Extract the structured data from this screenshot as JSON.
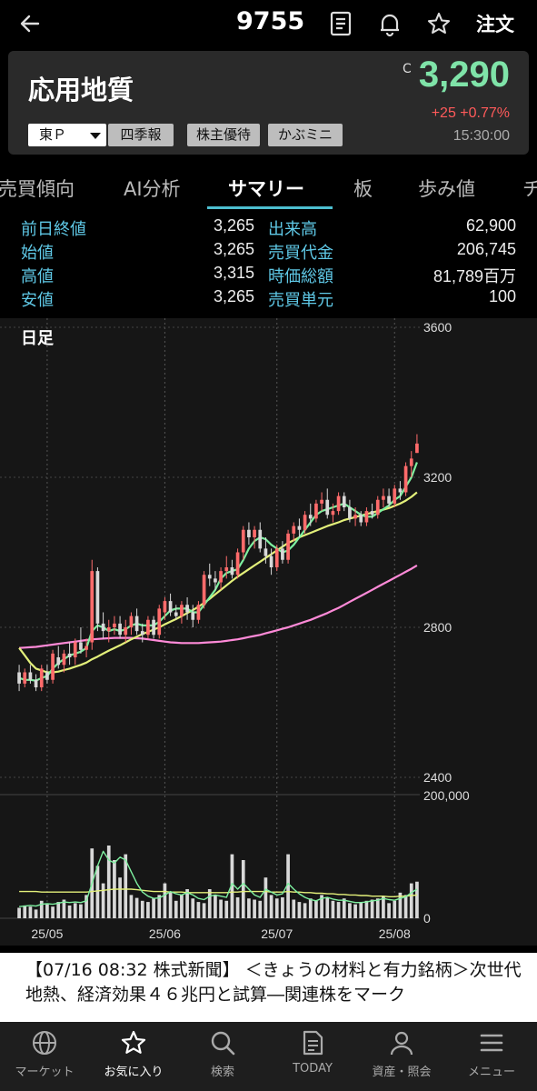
{
  "header": {
    "stock_code": "9755",
    "order_label": "注文",
    "icons": [
      "back-arrow-icon",
      "document-icon",
      "bell-icon",
      "star-icon"
    ]
  },
  "quote": {
    "company_name": "応用地質",
    "close_marker": "C",
    "price": "3,290",
    "change": "+25 +0.77%",
    "time": "15:30:00",
    "price_color": "#7fe3a8",
    "change_color": "#ff5a5a",
    "exchange": "東Ｐ",
    "tags": [
      "四季報",
      "株主優待",
      "かぶミニ"
    ]
  },
  "tabs": [
    {
      "label": "売買傾向",
      "active": false
    },
    {
      "label": "AI分析",
      "active": false
    },
    {
      "label": "サマリー",
      "active": true
    },
    {
      "label": "板",
      "active": false
    },
    {
      "label": "歩み値",
      "active": false
    },
    {
      "label": "チ",
      "active": false
    }
  ],
  "summary": {
    "left": [
      {
        "label": "前日終値",
        "value": "3,265"
      },
      {
        "label": "始値",
        "value": "3,265"
      },
      {
        "label": "高値",
        "value": "3,315"
      },
      {
        "label": "安値",
        "value": "3,265"
      }
    ],
    "right": [
      {
        "label": "出来高",
        "value": "62,900"
      },
      {
        "label": "売買代金",
        "value": "206,745"
      },
      {
        "label": "時価総額",
        "value": "81,789百万"
      },
      {
        "label": "売買単元",
        "value": "100"
      }
    ],
    "label_color": "#5fc8e6"
  },
  "chart_data": {
    "type": "candlestick",
    "period_label": "日足",
    "price_axis_labels": [
      "3600",
      "3200",
      "2800",
      "2400"
    ],
    "ylim": [
      2400,
      3600
    ],
    "volume_axis_labels": [
      "200,000",
      "0"
    ],
    "volume_ylim": [
      0,
      200000
    ],
    "x_labels": [
      {
        "label": "25/05",
        "index": 5
      },
      {
        "label": "25/06",
        "index": 26
      },
      {
        "label": "25/07",
        "index": 46
      },
      {
        "label": "25/08",
        "index": 67
      }
    ],
    "up_color": "#ff6b6b",
    "down_color": "#d8d8d8",
    "ma_short_color": "#7ef0a0",
    "ma_mid_color": "#e3f07a",
    "ma_long_color": "#ff8ad8",
    "candles": [
      {
        "o": 2680,
        "h": 2700,
        "l": 2630,
        "c": 2650
      },
      {
        "o": 2650,
        "h": 2690,
        "l": 2640,
        "c": 2680
      },
      {
        "o": 2680,
        "h": 2700,
        "l": 2650,
        "c": 2660
      },
      {
        "o": 2660,
        "h": 2675,
        "l": 2630,
        "c": 2640
      },
      {
        "o": 2640,
        "h": 2700,
        "l": 2630,
        "c": 2690
      },
      {
        "o": 2680,
        "h": 2700,
        "l": 2650,
        "c": 2660
      },
      {
        "o": 2660,
        "h": 2740,
        "l": 2650,
        "c": 2730
      },
      {
        "o": 2720,
        "h": 2750,
        "l": 2690,
        "c": 2700
      },
      {
        "o": 2700,
        "h": 2740,
        "l": 2680,
        "c": 2730
      },
      {
        "o": 2730,
        "h": 2760,
        "l": 2700,
        "c": 2720
      },
      {
        "o": 2720,
        "h": 2770,
        "l": 2700,
        "c": 2760
      },
      {
        "o": 2760,
        "h": 2800,
        "l": 2730,
        "c": 2740
      },
      {
        "o": 2740,
        "h": 2770,
        "l": 2720,
        "c": 2750
      },
      {
        "o": 2760,
        "h": 2980,
        "l": 2740,
        "c": 2950
      },
      {
        "o": 2950,
        "h": 2960,
        "l": 2790,
        "c": 2810
      },
      {
        "o": 2810,
        "h": 2840,
        "l": 2770,
        "c": 2790
      },
      {
        "o": 2790,
        "h": 2820,
        "l": 2760,
        "c": 2800
      },
      {
        "o": 2800,
        "h": 2830,
        "l": 2780,
        "c": 2810
      },
      {
        "o": 2810,
        "h": 2830,
        "l": 2770,
        "c": 2780
      },
      {
        "o": 2780,
        "h": 2820,
        "l": 2760,
        "c": 2800
      },
      {
        "o": 2800,
        "h": 2840,
        "l": 2780,
        "c": 2830
      },
      {
        "o": 2830,
        "h": 2850,
        "l": 2780,
        "c": 2790
      },
      {
        "o": 2790,
        "h": 2810,
        "l": 2760,
        "c": 2780
      },
      {
        "o": 2780,
        "h": 2830,
        "l": 2770,
        "c": 2820
      },
      {
        "o": 2820,
        "h": 2830,
        "l": 2770,
        "c": 2780
      },
      {
        "o": 2780,
        "h": 2860,
        "l": 2770,
        "c": 2850
      },
      {
        "o": 2840,
        "h": 2880,
        "l": 2820,
        "c": 2870
      },
      {
        "o": 2870,
        "h": 2890,
        "l": 2830,
        "c": 2840
      },
      {
        "o": 2840,
        "h": 2860,
        "l": 2820,
        "c": 2830
      },
      {
        "o": 2830,
        "h": 2870,
        "l": 2810,
        "c": 2860
      },
      {
        "o": 2860,
        "h": 2880,
        "l": 2820,
        "c": 2840
      },
      {
        "o": 2840,
        "h": 2860,
        "l": 2800,
        "c": 2820
      },
      {
        "o": 2820,
        "h": 2870,
        "l": 2810,
        "c": 2860
      },
      {
        "o": 2860,
        "h": 2950,
        "l": 2850,
        "c": 2940
      },
      {
        "o": 2940,
        "h": 2970,
        "l": 2910,
        "c": 2930
      },
      {
        "o": 2930,
        "h": 2950,
        "l": 2900,
        "c": 2920
      },
      {
        "o": 2920,
        "h": 2960,
        "l": 2900,
        "c": 2950
      },
      {
        "o": 2950,
        "h": 2990,
        "l": 2930,
        "c": 2960
      },
      {
        "o": 2960,
        "h": 2980,
        "l": 2930,
        "c": 2940
      },
      {
        "o": 2940,
        "h": 3010,
        "l": 2930,
        "c": 3000
      },
      {
        "o": 3000,
        "h": 3070,
        "l": 2980,
        "c": 3060
      },
      {
        "o": 3060,
        "h": 3080,
        "l": 3020,
        "c": 3040
      },
      {
        "o": 3040,
        "h": 3070,
        "l": 3010,
        "c": 3060
      },
      {
        "o": 3060,
        "h": 3080,
        "l": 3000,
        "c": 3010
      },
      {
        "o": 3010,
        "h": 3040,
        "l": 2970,
        "c": 2990
      },
      {
        "o": 2990,
        "h": 3010,
        "l": 2940,
        "c": 2960
      },
      {
        "o": 2960,
        "h": 3020,
        "l": 2950,
        "c": 3010
      },
      {
        "o": 3010,
        "h": 3030,
        "l": 2970,
        "c": 2980
      },
      {
        "o": 2980,
        "h": 3060,
        "l": 2970,
        "c": 3050
      },
      {
        "o": 3050,
        "h": 3080,
        "l": 3030,
        "c": 3070
      },
      {
        "o": 3070,
        "h": 3090,
        "l": 3040,
        "c": 3060
      },
      {
        "o": 3060,
        "h": 3110,
        "l": 3050,
        "c": 3100
      },
      {
        "o": 3100,
        "h": 3130,
        "l": 3070,
        "c": 3090
      },
      {
        "o": 3090,
        "h": 3140,
        "l": 3080,
        "c": 3130
      },
      {
        "o": 3130,
        "h": 3160,
        "l": 3110,
        "c": 3140
      },
      {
        "o": 3140,
        "h": 3170,
        "l": 3090,
        "c": 3100
      },
      {
        "o": 3100,
        "h": 3130,
        "l": 3080,
        "c": 3110
      },
      {
        "o": 3110,
        "h": 3160,
        "l": 3100,
        "c": 3150
      },
      {
        "o": 3150,
        "h": 3160,
        "l": 3110,
        "c": 3120
      },
      {
        "o": 3120,
        "h": 3140,
        "l": 3080,
        "c": 3090
      },
      {
        "o": 3090,
        "h": 3120,
        "l": 3070,
        "c": 3100
      },
      {
        "o": 3100,
        "h": 3110,
        "l": 3070,
        "c": 3080
      },
      {
        "o": 3080,
        "h": 3120,
        "l": 3070,
        "c": 3110
      },
      {
        "o": 3110,
        "h": 3130,
        "l": 3090,
        "c": 3100
      },
      {
        "o": 3100,
        "h": 3150,
        "l": 3090,
        "c": 3140
      },
      {
        "o": 3140,
        "h": 3170,
        "l": 3120,
        "c": 3150
      },
      {
        "o": 3150,
        "h": 3170,
        "l": 3120,
        "c": 3130
      },
      {
        "o": 3130,
        "h": 3180,
        "l": 3120,
        "c": 3170
      },
      {
        "o": 3170,
        "h": 3190,
        "l": 3140,
        "c": 3160
      },
      {
        "o": 3160,
        "h": 3240,
        "l": 3150,
        "c": 3230
      },
      {
        "o": 3230,
        "h": 3270,
        "l": 3200,
        "c": 3250
      },
      {
        "o": 3265,
        "h": 3315,
        "l": 3265,
        "c": 3290
      }
    ],
    "volumes": [
      18000,
      22000,
      20000,
      15000,
      30000,
      24000,
      20000,
      28000,
      32000,
      22000,
      26000,
      24000,
      40000,
      120000,
      90000,
      60000,
      125000,
      100000,
      70000,
      110000,
      40000,
      35000,
      30000,
      28000,
      34000,
      40000,
      60000,
      45000,
      30000,
      40000,
      50000,
      34000,
      28000,
      26000,
      50000,
      40000,
      32000,
      30000,
      110000,
      36000,
      100000,
      34000,
      32000,
      30000,
      70000,
      40000,
      34000,
      36000,
      110000,
      32000,
      28000,
      26000,
      34000,
      30000,
      40000,
      36000,
      30000,
      28000,
      34000,
      26000,
      24000,
      28000,
      30000,
      32000,
      34000,
      38000,
      26000,
      30000,
      44000,
      40000,
      60000,
      62900
    ],
    "ma_short": [
      2665,
      2660,
      2660,
      2658,
      2665,
      2670,
      2690,
      2705,
      2715,
      2725,
      2730,
      2735,
      2745,
      2790,
      2805,
      2800,
      2790,
      2795,
      2790,
      2795,
      2805,
      2810,
      2805,
      2805,
      2805,
      2815,
      2830,
      2845,
      2850,
      2850,
      2850,
      2840,
      2840,
      2860,
      2880,
      2900,
      2930,
      2945,
      2950,
      2955,
      2980,
      3010,
      3030,
      3040,
      3035,
      3020,
      3010,
      3000,
      3005,
      3020,
      3040,
      3060,
      3080,
      3100,
      3110,
      3115,
      3120,
      3125,
      3130,
      3120,
      3110,
      3100,
      3095,
      3095,
      3105,
      3115,
      3125,
      3140,
      3150,
      3175,
      3200,
      3240
    ],
    "ma_mid": [
      2745,
      2725,
      2705,
      2690,
      2685,
      2680,
      2680,
      2682,
      2686,
      2690,
      2695,
      2700,
      2706,
      2715,
      2722,
      2730,
      2738,
      2745,
      2752,
      2760,
      2768,
      2775,
      2782,
      2788,
      2794,
      2800,
      2808,
      2815,
      2822,
      2830,
      2838,
      2846,
      2855,
      2865,
      2876,
      2888,
      2900,
      2912,
      2924,
      2935,
      2945,
      2955,
      2965,
      2975,
      2985,
      2995,
      3005,
      3015,
      3025,
      3032,
      3040,
      3046,
      3052,
      3058,
      3064,
      3070,
      3075,
      3080,
      3086,
      3090,
      3094,
      3098,
      3102,
      3106,
      3110,
      3114,
      3118,
      3124,
      3130,
      3138,
      3148,
      3160
    ],
    "ma_long": [
      2745,
      2746,
      2747,
      2748,
      2750,
      2752,
      2754,
      2756,
      2758,
      2760,
      2762,
      2764,
      2766,
      2768,
      2769,
      2770,
      2771,
      2772,
      2772,
      2772,
      2772,
      2771,
      2770,
      2768,
      2766,
      2764,
      2762,
      2760,
      2759,
      2758,
      2758,
      2758,
      2758,
      2759,
      2760,
      2761,
      2762,
      2764,
      2766,
      2768,
      2771,
      2774,
      2777,
      2780,
      2784,
      2788,
      2792,
      2796,
      2800,
      2805,
      2810,
      2815,
      2820,
      2826,
      2832,
      2838,
      2845,
      2852,
      2860,
      2868,
      2876,
      2884,
      2892,
      2900,
      2908,
      2916,
      2924,
      2932,
      2940,
      2948,
      2956,
      2965
    ],
    "vol_ma_short": [
      20000,
      21000,
      22000,
      21000,
      24000,
      25000,
      24000,
      26000,
      28000,
      27000,
      28000,
      27000,
      30000,
      60000,
      90000,
      115000,
      100000,
      95000,
      105000,
      100000,
      80000,
      60000,
      45000,
      38000,
      34000,
      35000,
      40000,
      46000,
      42000,
      40000,
      44000,
      40000,
      34000,
      32000,
      38000,
      40000,
      38000,
      36000,
      60000,
      50000,
      60000,
      50000,
      40000,
      36000,
      50000,
      45000,
      40000,
      42000,
      60000,
      50000,
      42000,
      36000,
      32000,
      30000,
      34000,
      36000,
      33000,
      31000,
      31000,
      29000,
      27000,
      27000,
      28000,
      30000,
      31000,
      34000,
      32000,
      31000,
      34000,
      37000,
      44000,
      50000
    ],
    "vol_ma_long": [
      46000,
      46000,
      46000,
      46000,
      45000,
      45000,
      45000,
      45000,
      45000,
      45000,
      45000,
      45000,
      45000,
      46000,
      47000,
      48000,
      49000,
      50000,
      50000,
      50000,
      50000,
      49000,
      48000,
      47000,
      46000,
      46000,
      46000,
      45000,
      45000,
      45000,
      44000,
      44000,
      44000,
      44000,
      44000,
      44000,
      44000,
      44000,
      45000,
      45000,
      46000,
      46000,
      46000,
      46000,
      46000,
      45000,
      45000,
      45000,
      46000,
      45000,
      45000,
      44000,
      44000,
      43000,
      43000,
      42000,
      42000,
      41000,
      41000,
      40000,
      40000,
      39000,
      39000,
      38000,
      38000,
      38000,
      37000,
      37000,
      38000,
      38000,
      39000,
      40000
    ]
  },
  "news": {
    "text": "【07/16 08:32 株式新聞】 ＜きょうの材料と有力銘柄＞次世代地熱、経済効果４６兆円と試算―関連株をマーク"
  },
  "bottom_nav": [
    {
      "label": "マーケット",
      "icon": "globe-icon",
      "active": false
    },
    {
      "label": "お気に入り",
      "icon": "star-icon",
      "active": true
    },
    {
      "label": "検索",
      "icon": "search-icon",
      "active": false
    },
    {
      "label": "TODAY",
      "icon": "news-icon",
      "active": false
    },
    {
      "label": "資産・照会",
      "icon": "person-icon",
      "active": false
    },
    {
      "label": "メニュー",
      "icon": "menu-icon",
      "active": false
    }
  ]
}
